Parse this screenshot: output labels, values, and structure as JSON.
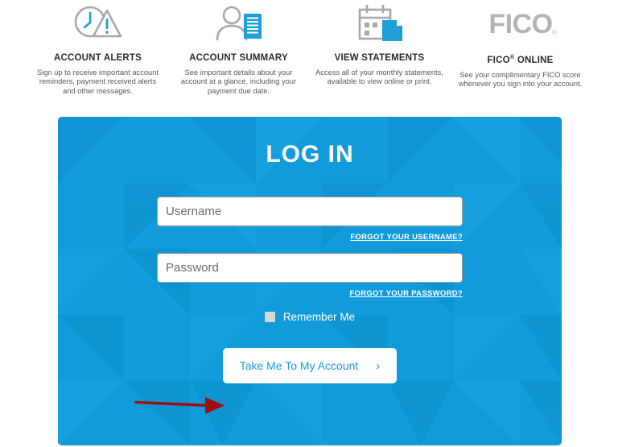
{
  "features": [
    {
      "icon": "clock-alert-icon",
      "title": "ACCOUNT ALERTS",
      "desc": "Sign up to receive important account reminders, payment received alerts and other messages."
    },
    {
      "icon": "person-document-icon",
      "title": "ACCOUNT SUMMARY",
      "desc": "See important details about your account at a glance, including your payment due date."
    },
    {
      "icon": "calendar-document-icon",
      "title": "VIEW STATEMENTS",
      "desc": "Access all of your monthly statements, available to view online or print."
    },
    {
      "icon": "fico-logo-icon",
      "title_pre": "FICO",
      "title_reg": "®",
      "title_post": "ONLINE",
      "title": "FICO ® ONLINE",
      "desc": "See your complimentary FICO score whenever you sign into your account."
    }
  ],
  "login": {
    "title": "LOG IN",
    "username": {
      "placeholder": "Username",
      "value": "",
      "forgot_label": "FORGOT YOUR USERNAME?"
    },
    "password": {
      "placeholder": "Password",
      "value": "",
      "forgot_label": "FORGOT YOUR PASSWORD?"
    },
    "remember_me_label": "Remember Me",
    "remember_me_checked": false,
    "submit_label": "Take Me To My Account",
    "submit_chevron": "›"
  },
  "colors": {
    "panel_blue": "#129bdb",
    "brand_blue": "#1b9ad6",
    "icon_gray": "#a8a8a8",
    "annotation_red": "#9e1010",
    "heading_text": "#2b2b2b",
    "body_text": "#585858"
  },
  "annotation": {
    "name": "red-pointer-arrow",
    "points_to": "Take Me To My Account"
  }
}
